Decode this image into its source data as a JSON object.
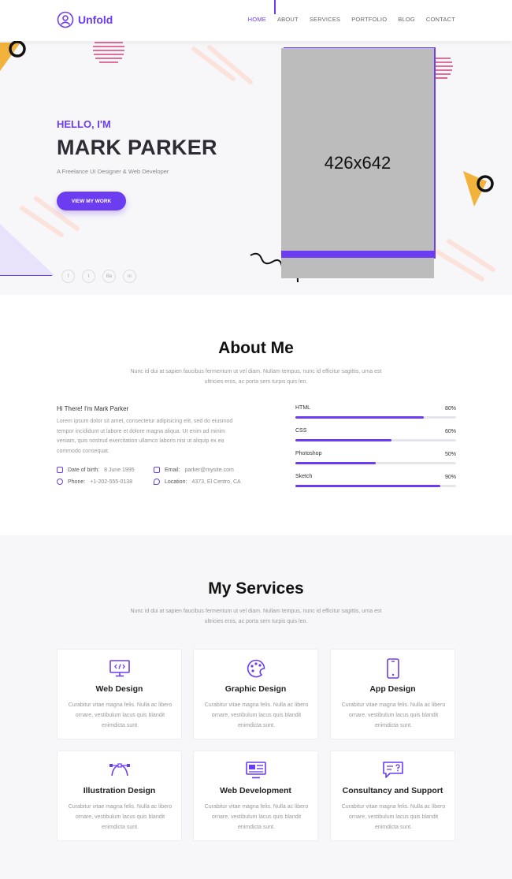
{
  "header": {
    "brand": "Unfold",
    "nav": [
      "HOME",
      "ABOUT",
      "SERVICES",
      "PORTFOLIO",
      "BLOG",
      "CONTACT"
    ]
  },
  "hero": {
    "greeting": "HELLO, I'M",
    "name": "MARK PARKER",
    "subtitle": "A Freelance UI Designer & Web Developer",
    "cta": "VIEW MY WORK",
    "photo_placeholder": "426x642",
    "socials": [
      "f",
      "t",
      "Be",
      "in"
    ],
    "socials_icons": [
      "facebook-icon",
      "twitter-icon",
      "behance-icon",
      "linkedin-icon"
    ]
  },
  "about": {
    "title": "About Me",
    "description": "Nunc id dui at sapien faucibus fermentum ut vel diam. Nullam tempus, nunc id efficitur sagittis, urna est ultricies eros, ac porta sem turpis quis leo.",
    "greeting": "Hi There! I'm Mark Parker",
    "bio": "Lorem ipsum dolor sit amet, consectetur adipisicing elit, sed do eiusmod tempor incididunt ut labore et dolore magna aliqua. Ut enim ad minim veniam, quis nostrud exercitation ullamco laboris nisi ut aliquip ex ea commodo consequat.",
    "info": {
      "dob_label": "Date of birth:",
      "dob": "8 June 1995",
      "email_label": "Email:",
      "email": "parker@mysite.com",
      "phone_label": "Phone:",
      "phone": "+1-202-555-0138",
      "location_label": "Location:",
      "location": "4373, El Centro, CA"
    },
    "skills": [
      {
        "name": "HTML",
        "percent": "80%",
        "value": 80
      },
      {
        "name": "CSS",
        "percent": "60%",
        "value": 60
      },
      {
        "name": "Photoshop",
        "percent": "50%",
        "value": 50
      },
      {
        "name": "Sketch",
        "percent": "90%",
        "value": 90
      }
    ]
  },
  "services": {
    "title": "My Services",
    "description": "Nunc id dui at sapien faucibus fermentum ut vel diam. Nullam tempus, nunc id efficitur sagittis, urna est ultricies eros, ac porta sem turpis quis leo.",
    "items": [
      {
        "title": "Web Design",
        "text": "Curabitur vitae magna felis. Nulla ac libero ornare, vestibulum lacus quis blandit enimdicta sunt.",
        "icon": "monitor-code-icon"
      },
      {
        "title": "Graphic Design",
        "text": "Curabitur vitae magna felis. Nulla ac libero ornare, vestibulum lacus quis blandit enimdicta sunt.",
        "icon": "palette-icon"
      },
      {
        "title": "App Design",
        "text": "Curabitur vitae magna felis. Nulla ac libero ornare, vestibulum lacus quis blandit enimdicta sunt.",
        "icon": "smartphone-icon"
      },
      {
        "title": "Illustration Design",
        "text": "Curabitur vitae magna felis. Nulla ac libero ornare, vestibulum lacus quis blandit enimdicta sunt.",
        "icon": "bezier-curve-icon"
      },
      {
        "title": "Web Development",
        "text": "Curabitur vitae magna felis. Nulla ac libero ornare, vestibulum lacus quis blandit enimdicta sunt.",
        "icon": "browser-layout-icon"
      },
      {
        "title": "Consultancy and Support",
        "text": "Curabitur vitae magna felis. Nulla ac libero ornare, vestibulum lacus quis blandit enimdicta sunt.",
        "icon": "chat-question-icon"
      }
    ]
  },
  "colors": {
    "accent": "#6c3df0",
    "hero_bg": "#f7f7f9",
    "photo_placeholder": "#bcbcbc"
  }
}
